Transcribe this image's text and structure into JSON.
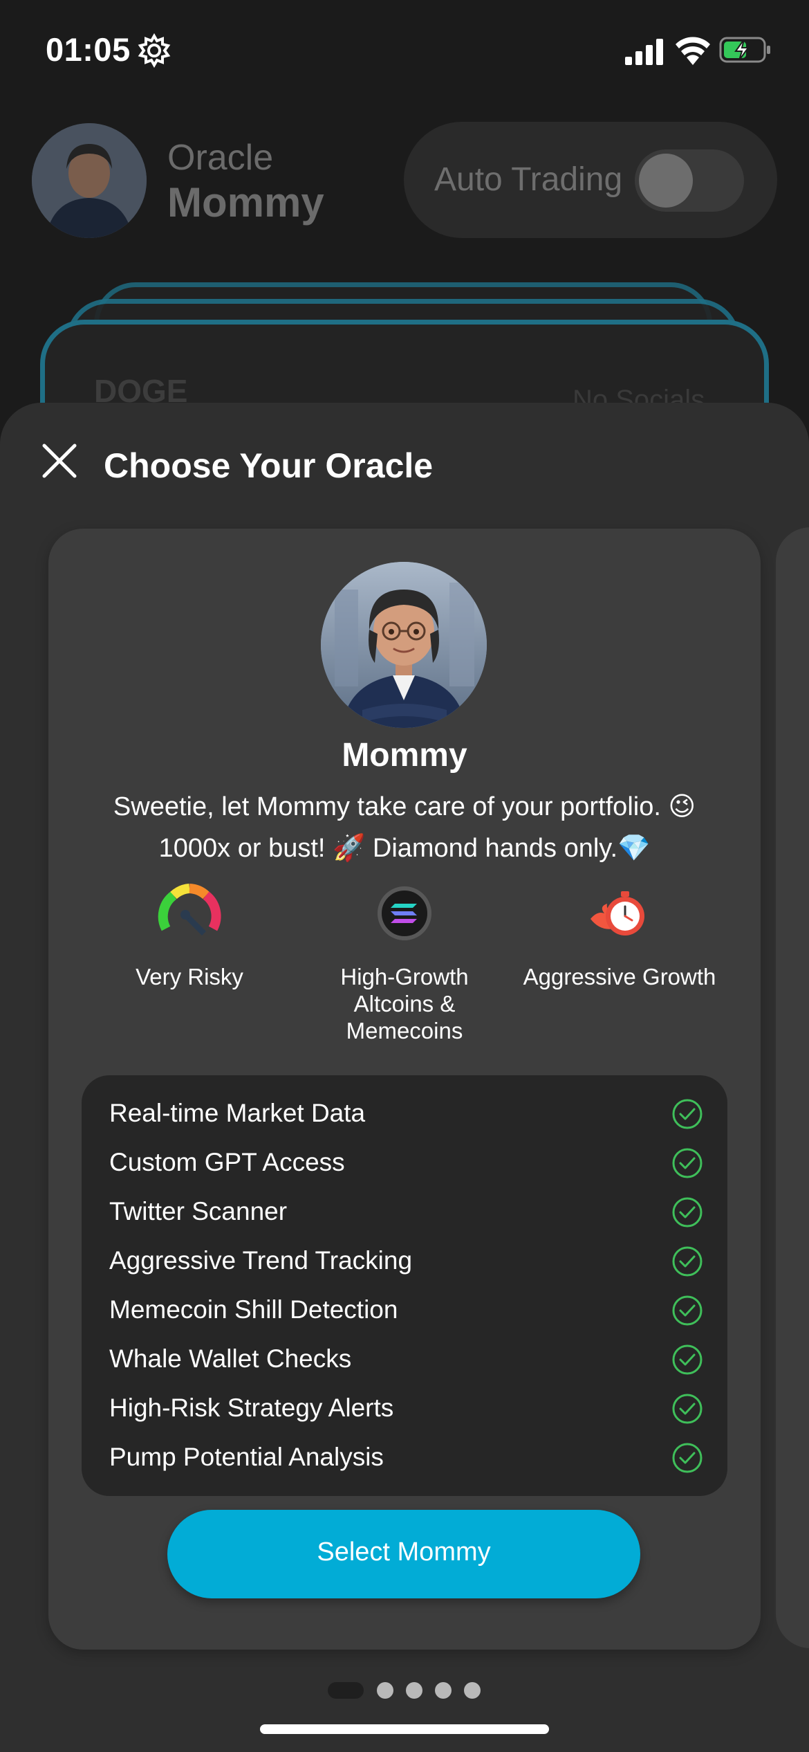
{
  "status_bar": {
    "time": "01:05",
    "icons": [
      "gear-icon",
      "signal-icon",
      "wifi-icon",
      "battery-charging-icon"
    ]
  },
  "header": {
    "name_small": "Oracle",
    "name_big": "Mommy",
    "auto_trading_label": "Auto Trading",
    "auto_trading_on": false
  },
  "background_card": {
    "ticker": "DOGE",
    "socials": "No Socials"
  },
  "sheet": {
    "title": "Choose Your Oracle",
    "oracle": {
      "name": "Mommy",
      "tagline_line1": "Sweetie, let Mommy take care of your portfolio. 😉",
      "tagline_line2": "1000x or bust! 🚀 Diamond hands only.💎",
      "traits": [
        {
          "icon": "risk-gauge-icon",
          "label": "Very Risky"
        },
        {
          "icon": "solana-coin-icon",
          "label": "High-Growth Altcoins & Memecoins"
        },
        {
          "icon": "flaming-stopwatch-icon",
          "label": "Aggressive Growth"
        }
      ],
      "features": [
        "Real-time Market Data",
        "Custom GPT Access",
        "Twitter Scanner",
        "Aggressive Trend Tracking",
        "Memecoin Shill Detection",
        "Whale Wallet Checks",
        "High-Risk Strategy Alerts",
        "Pump Potential Analysis"
      ],
      "select_label": "Select Mommy"
    },
    "pager": {
      "total": 5,
      "active": 0
    }
  },
  "colors": {
    "accent": "#02acd6",
    "check": "#3fbf5a",
    "sheet_bg": "#2f2f2f",
    "card_bg": "#3d3d3d"
  }
}
